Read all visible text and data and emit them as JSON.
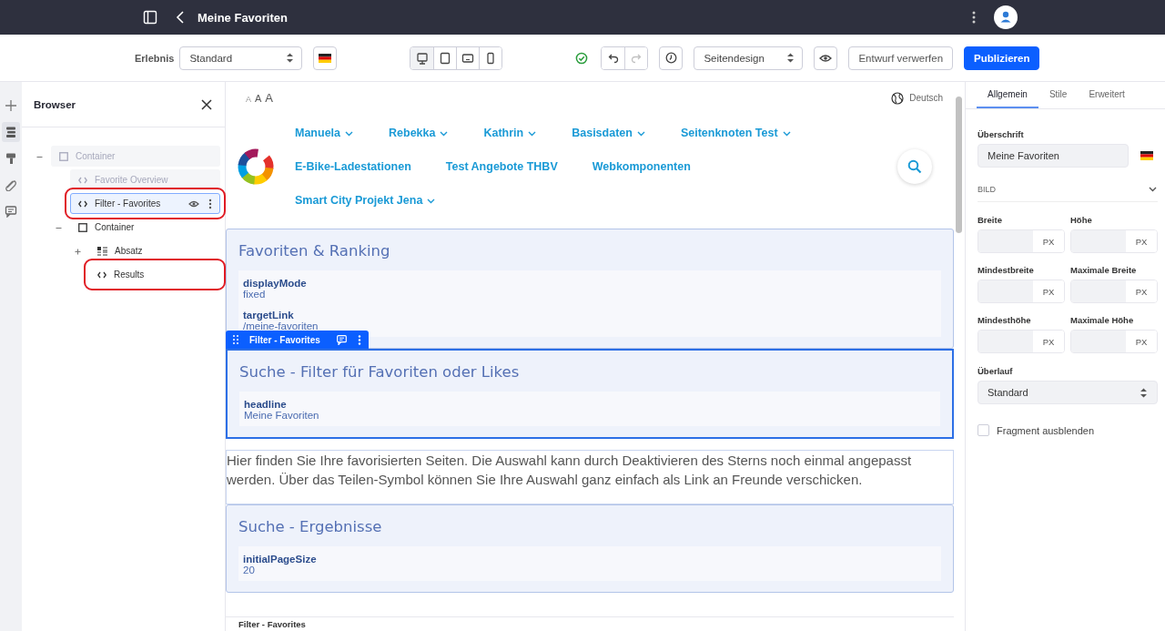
{
  "header": {
    "title": "Meine Favoriten"
  },
  "toolbar": {
    "experience_label": "Erlebnis",
    "experience_value": "Standard",
    "devices": [
      {
        "kind": "desktop",
        "selected": true
      },
      {
        "kind": "tablet",
        "selected": false
      },
      {
        "kind": "landscape",
        "selected": false
      },
      {
        "kind": "phone",
        "selected": false
      }
    ],
    "redo_disabled": true,
    "design_value": "Seitendesign",
    "discard_button": "Entwurf verwerfen",
    "publish_button": "Publizieren"
  },
  "side_rail": [
    {
      "kind": "add",
      "selected": false
    },
    {
      "kind": "browser",
      "selected": true
    },
    {
      "kind": "styles",
      "selected": false
    },
    {
      "kind": "link",
      "selected": false
    },
    {
      "kind": "comments",
      "selected": false
    }
  ],
  "browser": {
    "title": "Browser",
    "tree": [
      {
        "label": "Container",
        "kind": "container",
        "expanded": true,
        "faded": true,
        "selected": false,
        "highlighted": false,
        "children": [
          {
            "label": "Favorite Overview",
            "kind": "fragment",
            "faded": true,
            "selected": false,
            "highlighted": false
          },
          {
            "label": "Filter - Favorites",
            "kind": "fragment",
            "faded": false,
            "selected": true,
            "highlighted": true
          },
          {
            "label": "Container",
            "kind": "container",
            "expanded": true,
            "faded": false,
            "selected": false,
            "highlighted": false,
            "children": [
              {
                "label": "Absatz",
                "kind": "paragraph",
                "expanded": false,
                "faded": false,
                "selected": false,
                "highlighted": false
              },
              {
                "label": "Results",
                "kind": "fragment",
                "faded": false,
                "selected": false,
                "highlighted": true
              }
            ]
          }
        ]
      }
    ]
  },
  "site": {
    "font_sizes": [
      "A",
      "A",
      "A"
    ],
    "language": "Deutsch",
    "nav": [
      {
        "label": "Manuela",
        "dropdown": true
      },
      {
        "label": "Rebekka",
        "dropdown": true
      },
      {
        "label": "Kathrin",
        "dropdown": true
      },
      {
        "label": "Basisdaten",
        "dropdown": true
      },
      {
        "label": "Seitenknoten Test",
        "dropdown": true
      },
      {
        "label": "E-Bike-Ladestationen",
        "dropdown": false
      },
      {
        "label": "Test Angebote THBV",
        "dropdown": false
      },
      {
        "label": "Webkomponenten",
        "dropdown": false
      },
      {
        "label": "Smart City Projekt Jena",
        "dropdown": true
      }
    ],
    "fragments": [
      {
        "kind": "card",
        "title": "Favoriten & Ranking",
        "selected": false,
        "fields": [
          {
            "name": "displayMode",
            "value": "fixed"
          },
          {
            "name": "targetLink",
            "value": "/meine-favoriten"
          }
        ]
      },
      {
        "kind": "card",
        "title": "Suche - Filter für Favoriten oder Likes",
        "selected": true,
        "toolbar_label": "Filter - Favorites",
        "fields": [
          {
            "name": "headline",
            "value": "Meine Favoriten"
          }
        ]
      },
      {
        "kind": "text",
        "text": "Hier finden Sie Ihre favorisierten Seiten. Die Auswahl kann durch Deaktivieren des Sterns noch einmal angepasst werden. Über das Teilen-Symbol können Sie Ihre Auswahl ganz einfach als Link an Freunde verschicken."
      },
      {
        "kind": "card",
        "title": "Suche - Ergebnisse",
        "selected": false,
        "fields": [
          {
            "name": "initialPageSize",
            "value": "20"
          }
        ]
      }
    ],
    "breadcrumb": "Filter - Favorites"
  },
  "properties": {
    "tabs": [
      {
        "label": "Allgemein",
        "selected": true
      },
      {
        "label": "Stile",
        "selected": false
      },
      {
        "label": "Erweitert",
        "selected": false
      }
    ],
    "heading_label": "Überschrift",
    "heading_value": "Meine Favoriten",
    "section": {
      "title": "BILD",
      "expanded": true
    },
    "size_fields": [
      {
        "label": "Breite",
        "unit": "PX"
      },
      {
        "label": "Höhe",
        "unit": "PX"
      },
      {
        "label": "Mindestbreite",
        "unit": "PX"
      },
      {
        "label": "Maximale Breite",
        "unit": "PX"
      },
      {
        "label": "Mindesthöhe",
        "unit": "PX"
      },
      {
        "label": "Maximale Höhe",
        "unit": "PX"
      }
    ],
    "overflow_label": "Überlauf",
    "overflow_value": "Standard",
    "hide_checkbox": {
      "label": "Fragment ausblenden",
      "checked": false
    }
  }
}
